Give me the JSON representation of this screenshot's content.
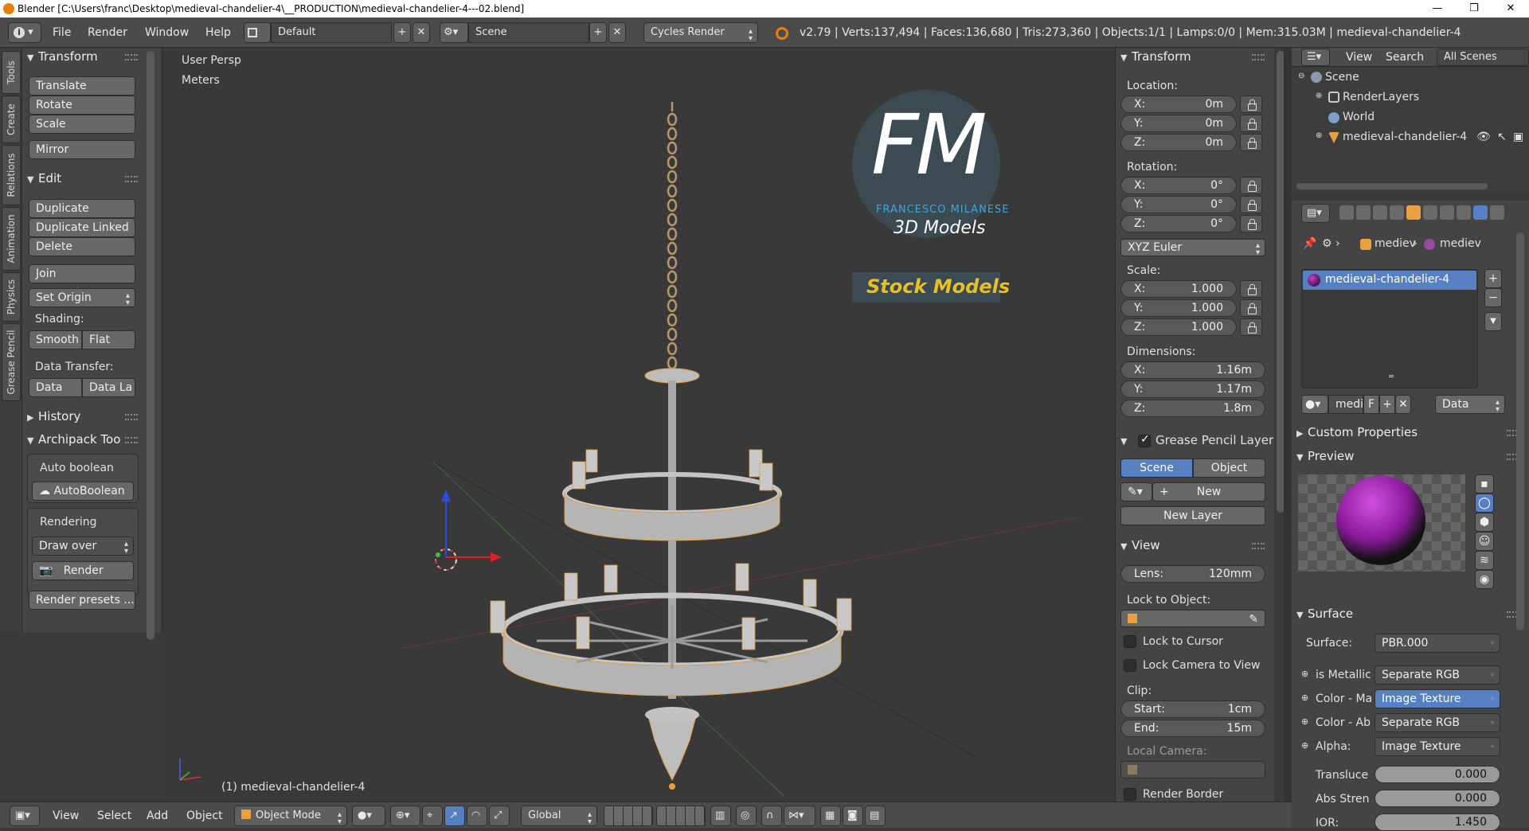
{
  "titlebar": {
    "title": "Blender [C:\\Users\\franc\\Desktop\\medieval-chandelier-4\\__PRODUCTION\\medieval-chandelier-4---02.blend]",
    "minimize": "—",
    "maximize": "❐",
    "close": "✕"
  },
  "topmenu": {
    "menus": [
      "File",
      "Render",
      "Window",
      "Help"
    ],
    "layout": "Default",
    "scene": "Scene",
    "engine": "Cycles Render",
    "stats": "v2.79 | Verts:137,494 | Faces:136,680 | Tris:273,360 | Objects:1/1 | Lamps:0/0 | Mem:315.03M | medieval-chandelier-4"
  },
  "tabs": [
    "Tools",
    "Create",
    "Relations",
    "Animation",
    "Physics",
    "Grease Pencil"
  ],
  "toolshelf": {
    "transform_header": "Transform",
    "transform": [
      "Translate",
      "Rotate",
      "Scale"
    ],
    "mirror": "Mirror",
    "edit_header": "Edit",
    "edit": [
      "Duplicate",
      "Duplicate Linked",
      "Delete"
    ],
    "join": "Join",
    "set_origin": "Set Origin",
    "shading_label": "Shading:",
    "smooth": "Smooth",
    "flat": "Flat",
    "data_transfer_label": "Data Transfer:",
    "data": "Data",
    "data_la": "Data La",
    "history_header": "History",
    "archipack_header": "Archipack Too",
    "auto_boolean_label": "Auto boolean",
    "auto_boolean_btn": "AutoBoolean",
    "rendering_label": "Rendering",
    "draw_over": "Draw over",
    "render_btn": "Render",
    "render_presets": "Render presets ..."
  },
  "viewport": {
    "view_name": "User Persp",
    "units": "Meters",
    "object_label": "(1) medieval-chandelier-4",
    "logo_letters": "FM",
    "logo_name": "FRANCESCO MILANESE",
    "logo_sub": "3D Models",
    "logo_banner": "Stock Models"
  },
  "npanel": {
    "transform_header": "Transform",
    "location_label": "Location:",
    "location": [
      {
        "k": "X:",
        "v": "0m"
      },
      {
        "k": "Y:",
        "v": "0m"
      },
      {
        "k": "Z:",
        "v": "0m"
      }
    ],
    "rotation_label": "Rotation:",
    "rotation": [
      {
        "k": "X:",
        "v": "0°"
      },
      {
        "k": "Y:",
        "v": "0°"
      },
      {
        "k": "Z:",
        "v": "0°"
      }
    ],
    "rotation_mode": "XYZ Euler",
    "scale_label": "Scale:",
    "scale": [
      {
        "k": "X:",
        "v": "1.000"
      },
      {
        "k": "Y:",
        "v": "1.000"
      },
      {
        "k": "Z:",
        "v": "1.000"
      }
    ],
    "dimensions_label": "Dimensions:",
    "dimensions": [
      {
        "k": "X:",
        "v": "1.16m"
      },
      {
        "k": "Y:",
        "v": "1.17m"
      },
      {
        "k": "Z:",
        "v": "1.8m"
      }
    ],
    "gp_header": "Grease Pencil Layer",
    "gp_scene": "Scene",
    "gp_object": "Object",
    "gp_new": "New",
    "gp_new_layer": "New Layer",
    "view_header": "View",
    "lens_k": "Lens:",
    "lens_v": "120mm",
    "lock_to_object": "Lock to Object:",
    "lock_to_cursor": "Lock to Cursor",
    "lock_camera": "Lock Camera to View",
    "clip_label": "Clip:",
    "clip_start_k": "Start:",
    "clip_start_v": "1cm",
    "clip_end_k": "End:",
    "clip_end_v": "15m",
    "local_camera": "Local Camera:",
    "render_border": "Render Border"
  },
  "outliner": {
    "view": "View",
    "search": "Search",
    "all_scenes": "All Scenes",
    "items": [
      "Scene",
      "RenderLayers",
      "World",
      "medieval-chandelier-4"
    ]
  },
  "props": {
    "breadcrumb_1": "mediev",
    "breadcrumb_2": "mediev",
    "material": "medieval-chandelier-4",
    "mat_field": "medi",
    "mat_f": "F",
    "data_select": "Data",
    "custom_props": "Custom Properties",
    "preview": "Preview",
    "surface_header": "Surface",
    "surface_label": "Surface:",
    "surface_value": "PBR.000",
    "inputs": [
      {
        "k": "is Metallic",
        "v": "Separate RGB"
      },
      {
        "k": "Color - Ma",
        "v": "Image Texture"
      },
      {
        "k": "Color - Ab",
        "v": "Separate RGB"
      },
      {
        "k": "Alpha:",
        "v": "Image Texture"
      }
    ],
    "transluce_k": "Transluce",
    "transluce_v": "0.000",
    "abs_k": "Abs Stren",
    "abs_v": "0.000",
    "ior_k": "IOR:",
    "ior_v": "1.450"
  },
  "bottombar": {
    "view": "View",
    "select": "Select",
    "add": "Add",
    "object": "Object",
    "mode": "Object Mode",
    "orientation": "Global"
  },
  "colors": {
    "accent": "#5680c2",
    "selection_orange": "#f0a030",
    "logo_blue": "#3aa8e0",
    "logo_gold": "#e8c020"
  }
}
